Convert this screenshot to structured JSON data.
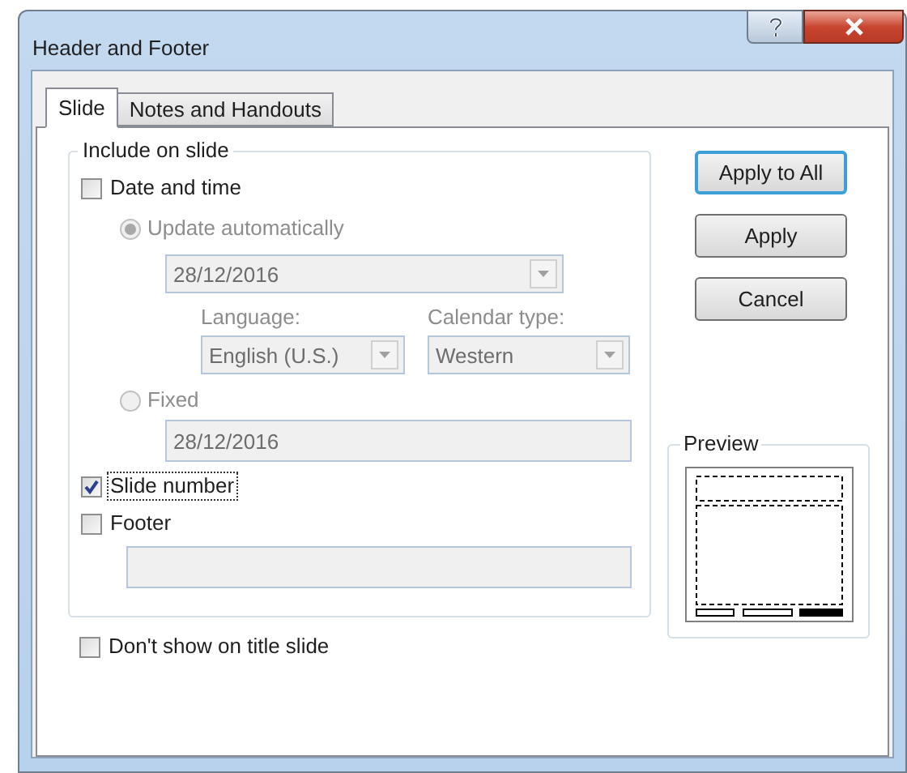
{
  "window": {
    "title": "Header and Footer"
  },
  "tabs": [
    {
      "label": "Slide",
      "selected": true
    },
    {
      "label": "Notes and Handouts",
      "selected": false
    }
  ],
  "include_group": {
    "title": "Include on slide",
    "date_and_time": {
      "label": "Date and time",
      "checked": false
    },
    "update_automatically": {
      "label": "Update automatically",
      "selected": true,
      "disabled": true,
      "value": "28/12/2016"
    },
    "language": {
      "label": "Language:",
      "value": "English (U.S.)",
      "disabled": true
    },
    "calendar_type": {
      "label": "Calendar type:",
      "value": "Western",
      "disabled": true
    },
    "fixed": {
      "label": "Fixed",
      "selected": false,
      "disabled": true,
      "value": "28/12/2016"
    },
    "slide_number": {
      "label": "Slide number",
      "checked": true,
      "focused": true
    },
    "footer": {
      "label": "Footer",
      "checked": false
    }
  },
  "dont_show_on_title_slide": {
    "label": "Don't show on title slide",
    "checked": false
  },
  "buttons": [
    {
      "label": "Apply to All",
      "default": true
    },
    {
      "label": "Apply",
      "default": false
    },
    {
      "label": "Cancel",
      "default": false
    }
  ],
  "preview": {
    "title": "Preview",
    "placeholders": [
      {
        "filled": false
      },
      {
        "filled": false
      },
      {
        "filled": true
      }
    ]
  }
}
